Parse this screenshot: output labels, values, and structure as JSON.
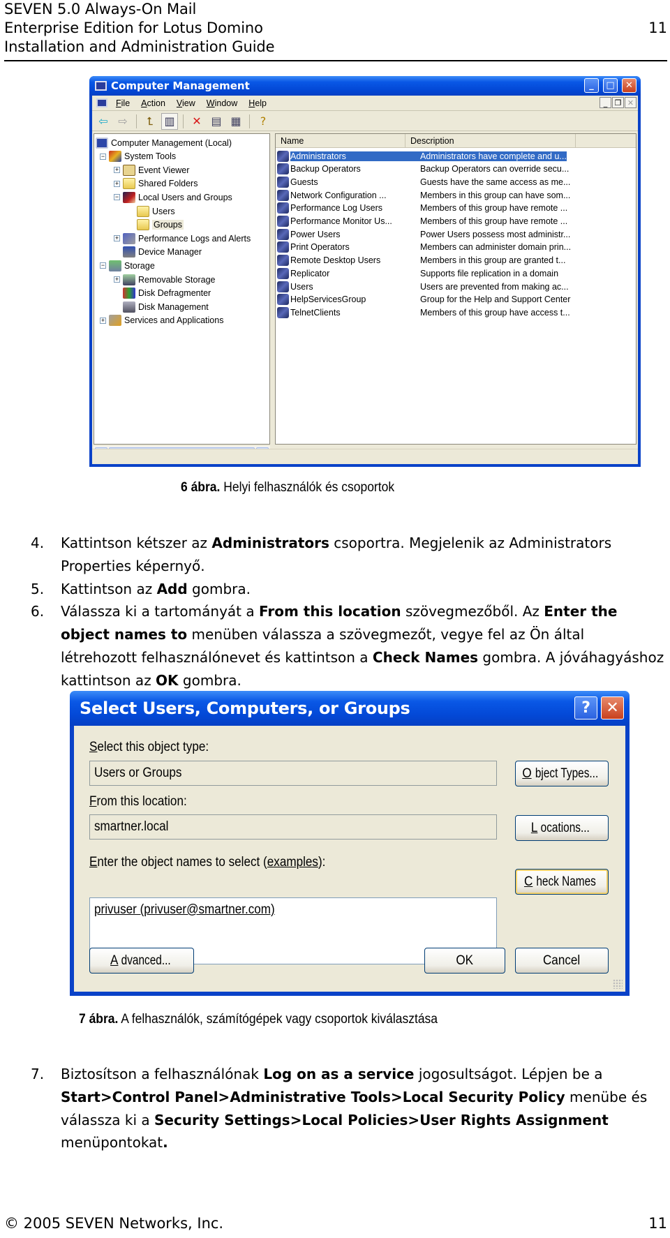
{
  "header": {
    "lines": [
      "SEVEN 5.0 Always-On Mail",
      "Enterprise Edition for Lotus Domino",
      "Installation and Administration Guide"
    ],
    "page_number": "11"
  },
  "computer_management": {
    "title": "Computer Management",
    "title_buttons": [
      "minimize",
      "maximize",
      "close"
    ],
    "menu": [
      {
        "label": "File",
        "accel": "F",
        "rest": "ile"
      },
      {
        "label": "Action",
        "accel": "A",
        "rest": "ction"
      },
      {
        "label": "View",
        "accel": "V",
        "rest": "iew"
      },
      {
        "label": "Window",
        "accel": "W",
        "rest": "indow"
      },
      {
        "label": "Help",
        "accel": "H",
        "rest": "elp"
      }
    ],
    "toolbar": [
      {
        "name": "back-icon",
        "glyph": "⇦",
        "color": "#1aa8c8"
      },
      {
        "name": "forward-icon",
        "glyph": "⇨",
        "color": "#a0a0a0"
      },
      {
        "name": "up-folder-icon",
        "glyph": "⮤",
        "color": "#806010"
      },
      {
        "name": "show-hide-tree-icon",
        "glyph": "▥",
        "color": "#303050"
      },
      {
        "name": "delete-icon",
        "glyph": "✕",
        "color": "#d81818"
      },
      {
        "name": "properties-icon",
        "glyph": "▤",
        "color": "#404060"
      },
      {
        "name": "export-list-icon",
        "glyph": "▦",
        "color": "#404060"
      },
      {
        "name": "help-icon",
        "glyph": "?",
        "color": "#b08000"
      }
    ],
    "tree": [
      {
        "label": "Computer Management (Local)",
        "level": 0,
        "expander": "",
        "icon": "comp"
      },
      {
        "label": "System Tools",
        "level": 1,
        "expander": "−",
        "icon": "tools"
      },
      {
        "label": "Event Viewer",
        "level": 2,
        "expander": "+",
        "icon": "event"
      },
      {
        "label": "Shared Folders",
        "level": 2,
        "expander": "+",
        "icon": "folder"
      },
      {
        "label": "Local Users and Groups",
        "level": 2,
        "expander": "−",
        "icon": "users"
      },
      {
        "label": "Users",
        "level": 3,
        "expander": "",
        "icon": "folder"
      },
      {
        "label": "Groups",
        "level": 3,
        "expander": "",
        "icon": "folder",
        "selected": true
      },
      {
        "label": "Performance Logs and Alerts",
        "level": 2,
        "expander": "+",
        "icon": "perf"
      },
      {
        "label": "Device Manager",
        "level": 2,
        "expander": "",
        "icon": "dev"
      },
      {
        "label": "Storage",
        "level": 1,
        "expander": "−",
        "icon": "storage"
      },
      {
        "label": "Removable Storage",
        "level": 2,
        "expander": "+",
        "icon": "remov"
      },
      {
        "label": "Disk Defragmenter",
        "level": 2,
        "expander": "",
        "icon": "defrag"
      },
      {
        "label": "Disk Management",
        "level": 2,
        "expander": "",
        "icon": "disk"
      },
      {
        "label": "Services and Applications",
        "level": 1,
        "expander": "+",
        "icon": "services"
      }
    ],
    "columns": [
      "Name",
      "Description"
    ],
    "groups": [
      {
        "name": "Administrators",
        "description": "Administrators have complete and u...",
        "selected": true
      },
      {
        "name": "Backup Operators",
        "description": "Backup Operators can override secu..."
      },
      {
        "name": "Guests",
        "description": "Guests have the same access as me..."
      },
      {
        "name": "Network Configuration ...",
        "description": "Members in this group can have som..."
      },
      {
        "name": "Performance Log Users",
        "description": "Members of this group have remote ..."
      },
      {
        "name": "Performance Monitor Us...",
        "description": "Members of this group have remote ..."
      },
      {
        "name": "Power Users",
        "description": "Power Users possess most administr..."
      },
      {
        "name": "Print Operators",
        "description": "Members can administer domain prin..."
      },
      {
        "name": "Remote Desktop Users",
        "description": "Members in this group are granted t..."
      },
      {
        "name": "Replicator",
        "description": "Supports file replication in a domain"
      },
      {
        "name": "Users",
        "description": "Users are prevented from making ac..."
      },
      {
        "name": "HelpServicesGroup",
        "description": "Group for the Help and Support Center"
      },
      {
        "name": "TelnetClients",
        "description": "Members of this group have access t..."
      }
    ]
  },
  "figure6": {
    "number": "6 ábra.",
    "text": "Helyi felhasználók és csoportok"
  },
  "steps_a": [
    {
      "num": "4.",
      "parts": [
        {
          "t": "Kattintson kétszer az ",
          "b": false
        },
        {
          "t": "Administrators",
          "b": true
        },
        {
          "t": " csoportra. Megjelenik az Administrators Properties képernyő.",
          "b": false
        }
      ]
    },
    {
      "num": "5.",
      "parts": [
        {
          "t": "Kattintson az ",
          "b": false
        },
        {
          "t": "Add",
          "b": true
        },
        {
          "t": " gombra.",
          "b": false
        }
      ]
    },
    {
      "num": "6.",
      "parts": [
        {
          "t": "Válassza ki a tartományát a ",
          "b": false
        },
        {
          "t": "From this location",
          "b": true
        },
        {
          "t": " szövegmezőből. Az ",
          "b": false
        },
        {
          "t": "Enter the object names to",
          "b": true
        },
        {
          "t": " menüben válassza a szövegmezőt, vegye fel az Ön által létrehozott felhasználónevet és kattintson a ",
          "b": false
        },
        {
          "t": "Check Names",
          "b": true
        },
        {
          "t": " gombra. A jóváhagyáshoz kattintson az ",
          "b": false
        },
        {
          "t": "OK",
          "b": true
        },
        {
          "t": " gombra.",
          "b": false
        }
      ]
    }
  ],
  "select_dialog": {
    "title": "Select Users, Computers, or Groups",
    "object_type_label": {
      "accel": "S",
      "rest": "elect this object type:"
    },
    "object_type_value": "Users or Groups",
    "object_types_button": {
      "accel": "O",
      "rest": "bject Types..."
    },
    "location_label": {
      "accel": "F",
      "rest": "rom this location:"
    },
    "location_value": "smartner.local",
    "locations_button": {
      "accel": "L",
      "rest": "ocations..."
    },
    "names_label": {
      "accel": "E",
      "rest": "nter the object names to select (",
      "link": "examples",
      "tail": "):"
    },
    "names_value": "privuser (privuser@smartner.com)",
    "check_names_button": {
      "accel": "C",
      "rest": "heck Names"
    },
    "advanced_button": {
      "accel": "A",
      "rest": "dvanced..."
    },
    "ok_button": "OK",
    "cancel_button": "Cancel"
  },
  "figure7": {
    "number": "7 ábra.",
    "text": "A felhasználók, számítógépek vagy csoportok kiválasztása"
  },
  "steps_b": [
    {
      "num": "7.",
      "parts": [
        {
          "t": "Biztosítson a felhasználónak ",
          "b": false
        },
        {
          "t": "Log on as a service",
          "b": true
        },
        {
          "t": " jogosultságot. Lépjen be a ",
          "b": false
        },
        {
          "t": "Start>Control Panel>Administrative Tools>Local Security Policy",
          "b": true
        },
        {
          "t": " menübe és válassza ki a ",
          "b": false
        },
        {
          "t": "Security Settings>Local Policies>User Rights Assignment",
          "b": true
        },
        {
          "t": " menüpontokat",
          "b": false
        },
        {
          "t": ".",
          "b": true
        }
      ]
    }
  ],
  "footer": {
    "copyright": "© 2005 SEVEN Networks, Inc.",
    "page_number": "11"
  }
}
